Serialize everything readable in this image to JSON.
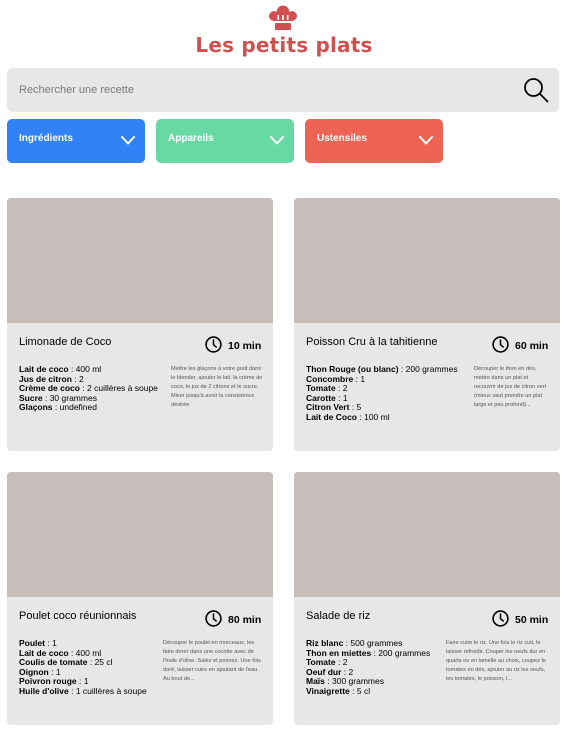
{
  "header": {
    "logo_icon": "chef-hat-icon",
    "brand": "Les petits plats",
    "brand_color": "#D04F4F"
  },
  "search": {
    "placeholder": "Rechercher une recette",
    "value": "",
    "icon": "search-icon"
  },
  "filters": [
    {
      "label": "Ingrédients",
      "color": "#3282F7"
    },
    {
      "label": "Appareils",
      "color": "#68D9A4"
    },
    {
      "label": "Ustensiles",
      "color": "#ED6454"
    }
  ],
  "recipes": [
    {
      "title": "Limonade de Coco",
      "time": "10 min",
      "ingredients": [
        {
          "name": "Lait de coco",
          "qty": " : 400 ml"
        },
        {
          "name": "Jus de citron",
          "qty": " : 2"
        },
        {
          "name": "Crème de coco",
          "qty": " : 2 cuillères à soupe"
        },
        {
          "name": "Sucre",
          "qty": " : 30 grammes"
        },
        {
          "name": "Glaçons",
          "qty": " : undefined"
        }
      ],
      "description": "Mettre les glaçons à votre goût dans le blender, ajouter le lait, la crème de coco, le jus de 2 citrons et le sucre. Mixer jusqu'à avoir la consistence désirée"
    },
    {
      "title": "Poisson Cru à la tahitienne",
      "time": "60 min",
      "ingredients": [
        {
          "name": "Thon Rouge (ou blanc)",
          "qty": " : 200 grammes"
        },
        {
          "name": "Concombre",
          "qty": " : 1"
        },
        {
          "name": "Tomate",
          "qty": " : 2"
        },
        {
          "name": "Carotte",
          "qty": " : 1"
        },
        {
          "name": "Citron Vert",
          "qty": " : 5"
        },
        {
          "name": "Lait de Coco",
          "qty": " : 100 ml"
        }
      ],
      "description": "Découper le thon en dés, mettre dans un plat et recouvrir de jus de citron vert (mieux vaut prendre un plat large et peu profond)..."
    },
    {
      "title": "Poulet coco réunionnais",
      "time": "80 min",
      "ingredients": [
        {
          "name": "Poulet",
          "qty": " : 1"
        },
        {
          "name": "Lait de coco",
          "qty": " : 400 ml"
        },
        {
          "name": "Coulis de tomate",
          "qty": " : 25 cl"
        },
        {
          "name": "Oignon",
          "qty": " : 1"
        },
        {
          "name": "Poivron rouge",
          "qty": " : 1"
        },
        {
          "name": "Huile d'olive",
          "qty": " : 1 cuillères à soupe"
        }
      ],
      "description": "Découper le poulet en morceaux, les faire dorer dans une cocotte avec de l'huile d'olive. Salez et poivrez. Une fois doré, laisser cuire en ajoutant de l'eau. Au bout de..."
    },
    {
      "title": "Salade de riz",
      "time": "50 min",
      "ingredients": [
        {
          "name": "Riz blanc",
          "qty": " : 500 grammes"
        },
        {
          "name": "Thon en miettes",
          "qty": " : 200 grammes"
        },
        {
          "name": "Tomate",
          "qty": " : 2"
        },
        {
          "name": "Oeuf dur",
          "qty": " : 2"
        },
        {
          "name": "Maïs",
          "qty": " : 300 grammes"
        },
        {
          "name": "Vinaigrette",
          "qty": " : 5 cl"
        }
      ],
      "description": "Faire cuire le riz. Une fois le riz cuit, le laisser refroidir. Couper les oeufs dur en quarts ou en lamelle au choix, coupez le tomates en dés, ajouter au riz les oeufs, les tomates, le poisson, l..."
    }
  ]
}
